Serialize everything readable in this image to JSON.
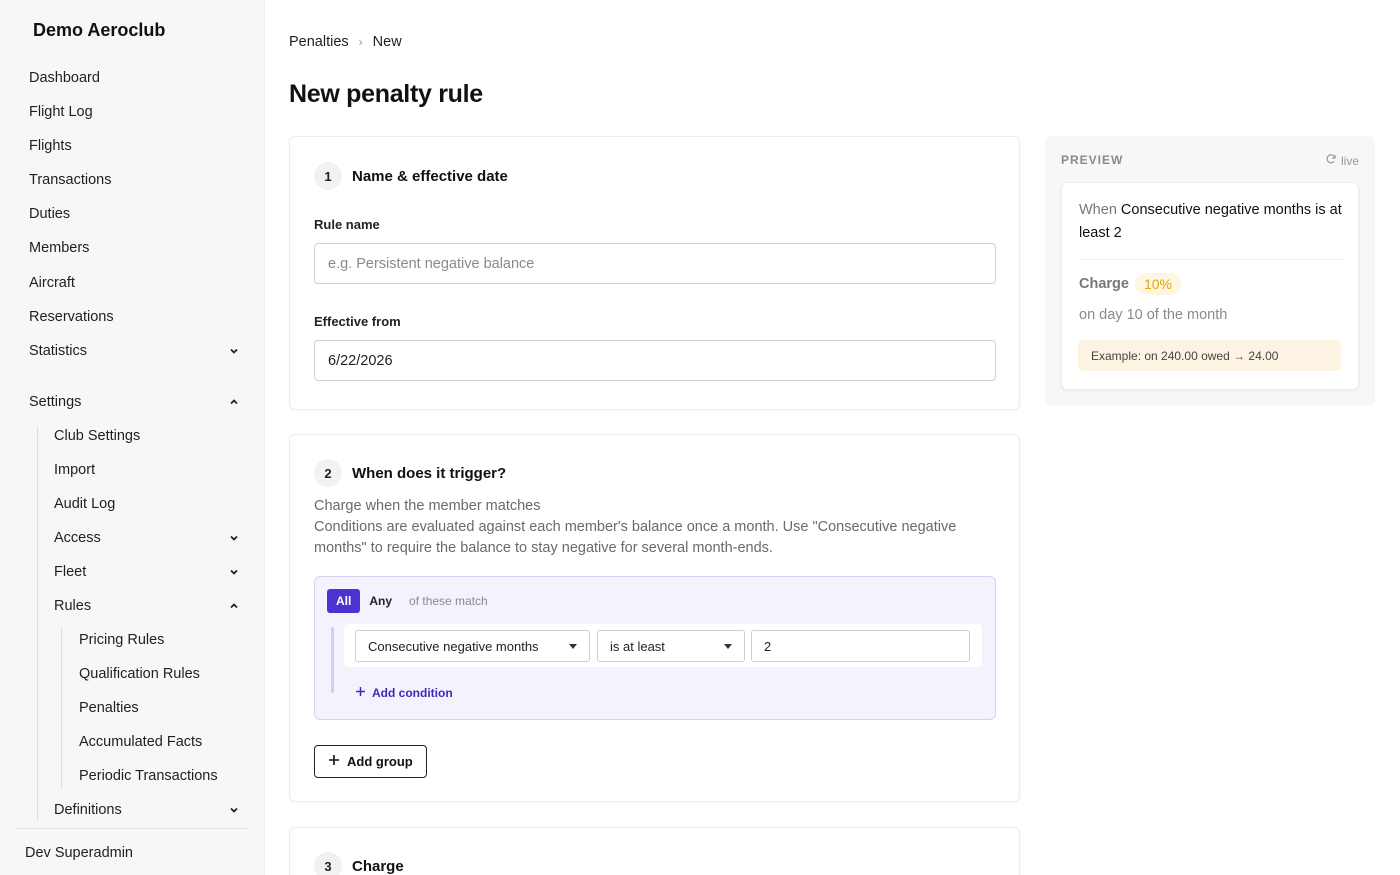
{
  "app": {
    "name": "Demo Aeroclub"
  },
  "sidebar": {
    "items": [
      {
        "label": "Dashboard"
      },
      {
        "label": "Flight Log"
      },
      {
        "label": "Flights"
      },
      {
        "label": "Transactions"
      },
      {
        "label": "Duties"
      },
      {
        "label": "Members"
      },
      {
        "label": "Aircraft"
      },
      {
        "label": "Reservations"
      },
      {
        "label": "Statistics"
      },
      {
        "label": "Settings"
      }
    ],
    "settings_children": [
      {
        "label": "Club Settings"
      },
      {
        "label": "Import"
      },
      {
        "label": "Audit Log"
      },
      {
        "label": "Access"
      },
      {
        "label": "Fleet"
      },
      {
        "label": "Rules"
      },
      {
        "label": "Definitions"
      }
    ],
    "rules_children": [
      {
        "label": "Pricing Rules"
      },
      {
        "label": "Qualification Rules"
      },
      {
        "label": "Penalties"
      },
      {
        "label": "Accumulated Facts"
      },
      {
        "label": "Periodic Transactions"
      }
    ],
    "user": "Dev Superadmin"
  },
  "breadcrumb": {
    "parent": "Penalties",
    "current": "New"
  },
  "page": {
    "title": "New penalty rule"
  },
  "step1": {
    "number": "1",
    "title": "Name & effective date",
    "rule_name_label": "Rule name",
    "rule_name_placeholder": "e.g. Persistent negative balance",
    "effective_label": "Effective from",
    "effective_value": "6/22/2026"
  },
  "step2": {
    "number": "2",
    "title": "When does it trigger?",
    "subtitle": "Charge when the member matches",
    "description": "Conditions are evaluated against each member's balance once a month. Use \"Consecutive negative months\" to require the balance to stay negative for several month-ends.",
    "match_all": "All",
    "match_any": "Any",
    "match_hint": "of these match",
    "condition": {
      "field": "Consecutive negative months",
      "operator": "is at least",
      "value": "2"
    },
    "add_condition": "Add condition",
    "add_group": "Add group"
  },
  "step3": {
    "number": "3",
    "title": "Charge"
  },
  "preview": {
    "label": "PREVIEW",
    "live": "live",
    "when_word": "When",
    "when_text": "Consecutive negative months is at least 2",
    "charge_label": "Charge",
    "charge_value": "10%",
    "day_text": "on day 10 of the month",
    "example": "Example: on 240.00 owed → 24.00"
  },
  "colors": {
    "accent": "#4a33d1",
    "link": "#3d2bb8",
    "badge_text": "#e0a800",
    "example_bg": "#fdf3e2"
  }
}
